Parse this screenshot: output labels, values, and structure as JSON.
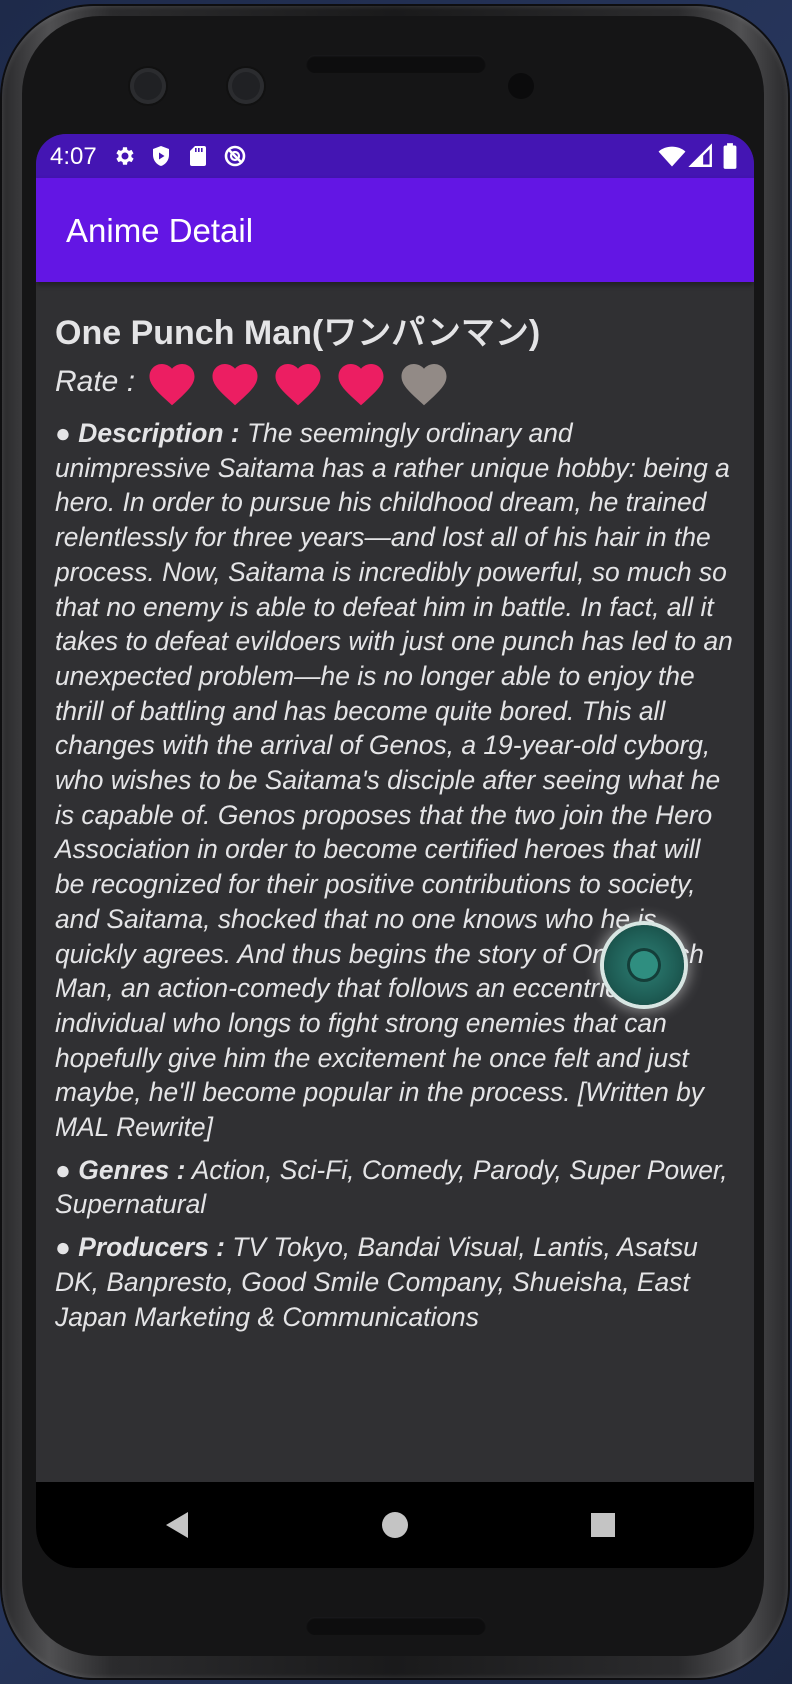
{
  "status_bar": {
    "time": "4:07",
    "left_icons": [
      "gear-icon",
      "shield-icon",
      "sd-card-icon",
      "no-disturb-icon"
    ],
    "right_icons": [
      "wifi-icon",
      "signal-icon",
      "battery-icon"
    ]
  },
  "app_bar": {
    "title": "Anime Detail"
  },
  "anime": {
    "title": "One Punch Man(ワンパンマン)",
    "rate_label": "Rate :",
    "rating": 4,
    "rating_max": 5,
    "colors": {
      "filled": "#ec1e62",
      "empty": "#928a86"
    },
    "bullet": "●",
    "description_label": "Description :",
    "description": "The seemingly ordinary and unimpressive Saitama has a rather unique hobby: being a hero. In order to pursue his childhood dream, he trained relentlessly for three years—and lost all of his hair in the process. Now, Saitama is incredibly powerful, so much so that no enemy is able to defeat him in battle. In fact, all it takes to defeat evildoers with just one punch has led to an unexpected problem—he is no longer able to enjoy the thrill of battling and has become quite bored. This all changes with the arrival of Genos, a 19-year-old cyborg, who wishes to be Saitama's disciple after seeing what he is capable of. Genos proposes that the two join the Hero Association in order to become certified heroes that will be recognized for their positive contributions to society, and Saitama, shocked that no one knows who he is, quickly agrees. And thus begins the story of One Punch Man, an action-comedy that follows an eccentric individual who longs to fight strong enemies that can hopefully give him the excitement he once felt and just maybe, he'll become popular in the process. [Written by MAL Rewrite]",
    "genres_label": "Genres :",
    "genres": "Action, Sci-Fi, Comedy, Parody, Super Power, Supernatural",
    "producers_label": "Producers :",
    "producers": "TV Tokyo, Bandai Visual, Lantis, Asatsu DK, Banpresto, Good Smile Company, Shueisha, East Japan Marketing & Communications"
  },
  "nav_bar": {
    "icons": [
      "back-icon",
      "home-icon",
      "recents-icon"
    ]
  },
  "theme": {
    "status_bar": "#4415b3",
    "app_bar": "#6316e4",
    "background": "#303033"
  }
}
